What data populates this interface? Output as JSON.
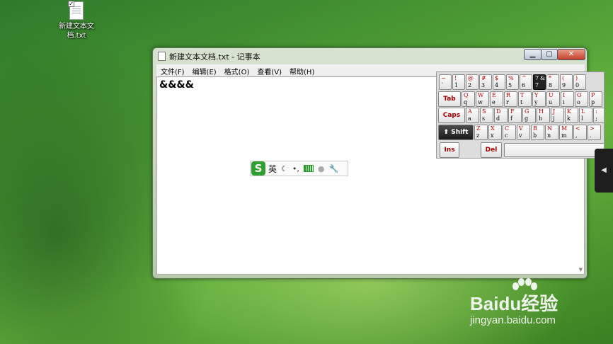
{
  "desktop": {
    "icon_label": "新建文本文档.txt"
  },
  "window": {
    "title": "新建文本文档.txt - 记事本",
    "controls": {
      "minimize": "▁",
      "maximize": "▢",
      "close": "✕"
    },
    "menu": [
      "文件(F)",
      "编辑(E)",
      "格式(O)",
      "查看(V)",
      "帮助(H)"
    ],
    "content": "&&&&"
  },
  "ime": {
    "logo": "S",
    "lang": "英",
    "icons": [
      "moon-icon",
      "punctuation-icon",
      "keyboard-icon",
      "user-icon",
      "wrench-icon"
    ]
  },
  "keyboard": {
    "row1": [
      [
        "~",
        "`",
        "",
        ""
      ],
      [
        "!",
        "1",
        "",
        ""
      ],
      [
        "@",
        "2",
        "",
        ""
      ],
      [
        "#",
        "3",
        "",
        ""
      ],
      [
        "$",
        "4",
        "",
        ""
      ],
      [
        "%",
        "5",
        "",
        ""
      ],
      [
        "^",
        "6",
        "",
        ""
      ],
      [
        "7",
        "7",
        "&",
        ""
      ],
      [
        "*",
        "8",
        "",
        ""
      ],
      [
        "(",
        "9",
        "",
        ""
      ],
      [
        ")",
        "0",
        "",
        ""
      ]
    ],
    "row2": [
      [
        "Q",
        "q",
        "",
        ""
      ],
      [
        "W",
        "w",
        "",
        ""
      ],
      [
        "E",
        "e",
        "",
        ""
      ],
      [
        "R",
        "r",
        "",
        ""
      ],
      [
        "T",
        "t",
        "",
        ""
      ],
      [
        "Y",
        "y",
        "",
        ""
      ],
      [
        "U",
        "u",
        "",
        ""
      ],
      [
        "I",
        "i",
        "",
        ""
      ],
      [
        "O",
        "o",
        "",
        ""
      ],
      [
        "P",
        "p",
        "",
        ""
      ]
    ],
    "row3": [
      [
        "A",
        "a",
        "",
        ""
      ],
      [
        "S",
        "s",
        "",
        ""
      ],
      [
        "D",
        "d",
        "",
        ""
      ],
      [
        "F",
        "f",
        "",
        ""
      ],
      [
        "G",
        "g",
        "",
        ""
      ],
      [
        "H",
        "h",
        "",
        ""
      ],
      [
        "J",
        "j",
        "",
        ""
      ],
      [
        "K",
        "k",
        "",
        ""
      ],
      [
        "L",
        "l",
        "",
        ""
      ],
      [
        ":",
        ";",
        "",
        ""
      ]
    ],
    "row4": [
      [
        "Z",
        "z",
        "",
        ""
      ],
      [
        "X",
        "x",
        "",
        ""
      ],
      [
        "C",
        "c",
        "",
        ""
      ],
      [
        "V",
        "v",
        "",
        ""
      ],
      [
        "B",
        "b",
        "",
        ""
      ],
      [
        "N",
        "n",
        "",
        ""
      ],
      [
        "M",
        "m",
        "",
        ""
      ],
      [
        "<",
        ",",
        "",
        ""
      ],
      [
        ">",
        ".",
        "",
        ""
      ]
    ],
    "special": {
      "tab": "Tab",
      "caps": "Caps",
      "shift": "Shift",
      "ins": "Ins",
      "del": "Del"
    }
  },
  "side_tab": {
    "arrow": "◀"
  },
  "watermark": {
    "logo": "Baidu经验",
    "url": "jingyan.baidu.com"
  }
}
